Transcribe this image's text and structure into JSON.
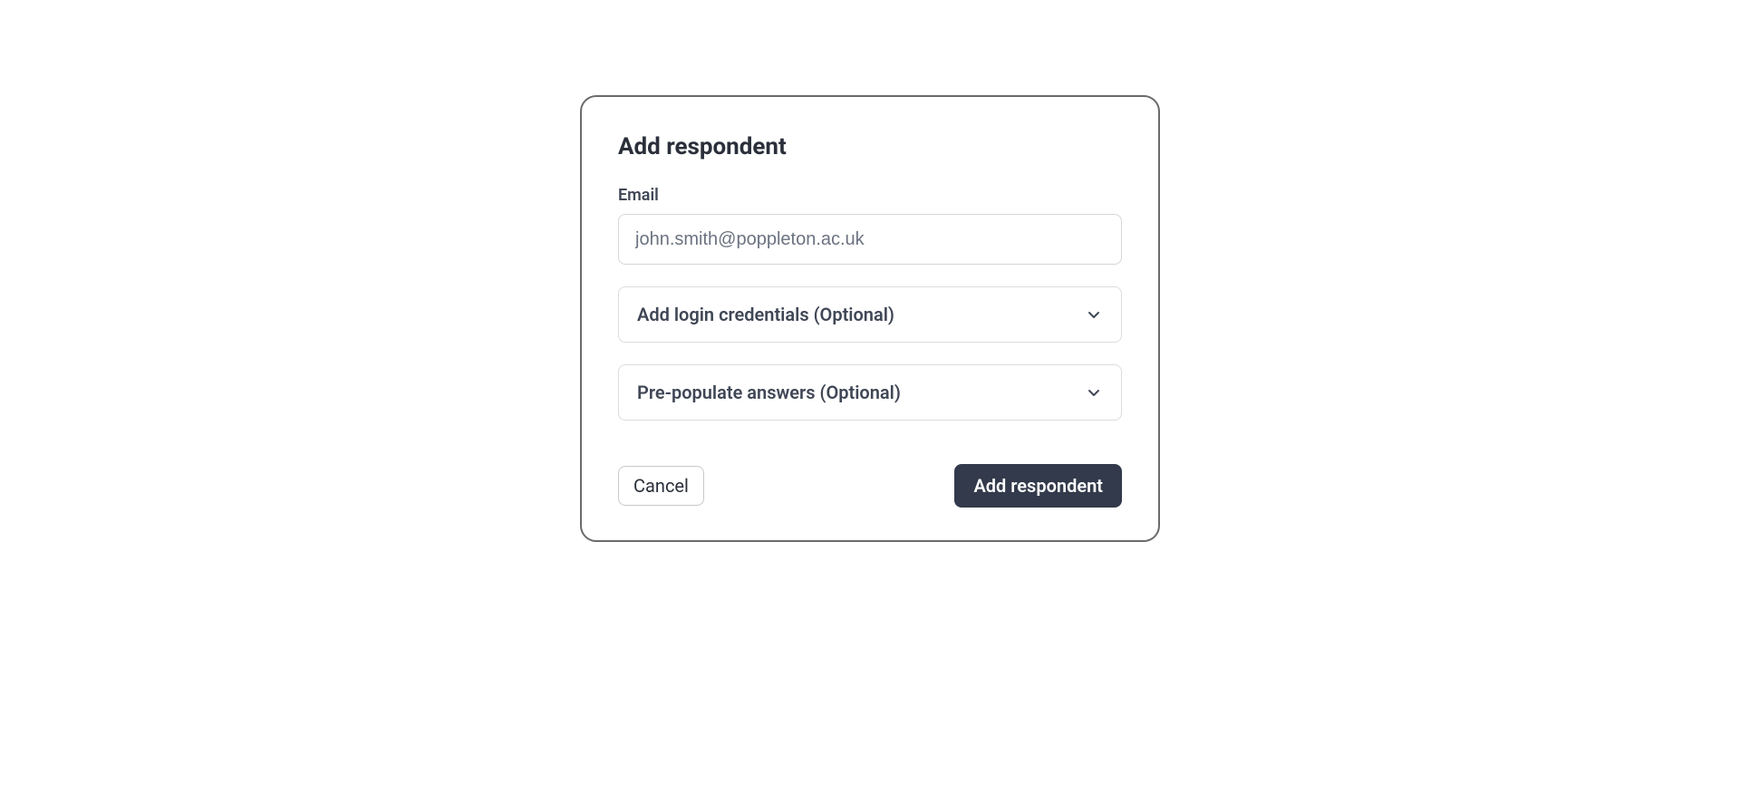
{
  "modal": {
    "title": "Add respondent",
    "email_label": "Email",
    "email_placeholder": "john.smith@poppleton.ac.uk",
    "accordion_login": "Add login credentials (Optional)",
    "accordion_prepopulate": "Pre-populate answers (Optional)",
    "cancel_label": "Cancel",
    "submit_label": "Add respondent"
  }
}
